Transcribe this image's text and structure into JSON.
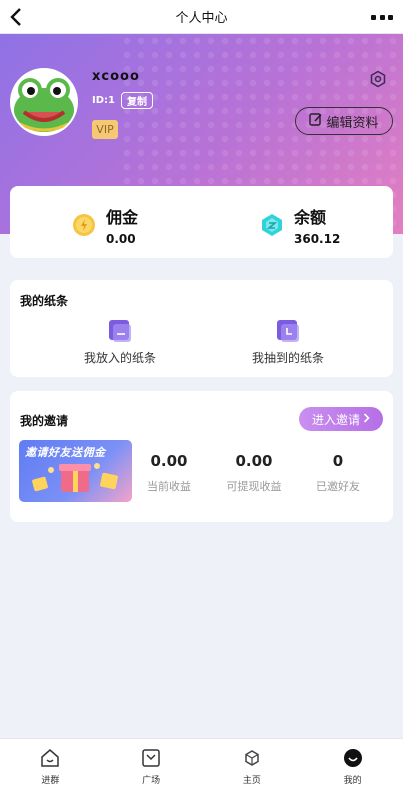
{
  "navbar": {
    "title": "个人中心"
  },
  "profile": {
    "username": "xcooo",
    "id_text": "ID:1",
    "copy_label": "复制",
    "vip_label": "VIP",
    "edit_label": "编辑资料"
  },
  "balance": {
    "commission": {
      "label": "佣金",
      "value": "0.00"
    },
    "balance": {
      "label": "余额",
      "value": "360.12"
    }
  },
  "notes": {
    "title": "我的纸条",
    "items": [
      {
        "label": "我放入的纸条"
      },
      {
        "label": "我抽到的纸条"
      }
    ]
  },
  "invite": {
    "title": "我的邀请",
    "button_label": "进入邀请",
    "banner_text": "邀请好友送佣金",
    "stats": [
      {
        "value": "0.00",
        "label": "当前收益"
      },
      {
        "value": "0.00",
        "label": "可提现收益"
      },
      {
        "value": "0",
        "label": "已邀好友"
      }
    ]
  },
  "tabbar": {
    "items": [
      {
        "label": "进群"
      },
      {
        "label": "广场"
      },
      {
        "label": "主页"
      },
      {
        "label": "我的"
      }
    ]
  },
  "colors": {
    "header_gradient_start": "#8f72e6",
    "header_gradient_end": "#e37fc1",
    "invite_button": "#c98ff0",
    "vip": "#f7c873"
  }
}
